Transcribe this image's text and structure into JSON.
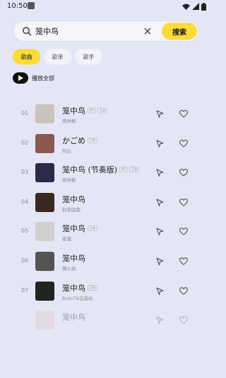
{
  "status": {
    "time": "10:50"
  },
  "search": {
    "query": "笼中鸟",
    "button_label": "搜索"
  },
  "tabs": [
    {
      "label": "歌曲",
      "active": true
    },
    {
      "label": "歌单",
      "active": false
    },
    {
      "label": "歌手",
      "active": false
    }
  ],
  "play_all": {
    "label": "播放全部"
  },
  "songs": [
    {
      "index": "01",
      "title": "笼中鸟",
      "tags": [
        "HF",
        "王者"
      ],
      "artist": "周林枫",
      "cover_color": "#c9c3bd"
    },
    {
      "index": "02",
      "title": "かごめ",
      "tags": [
        "王者"
      ],
      "artist": "阿云",
      "cover_color": "#8a5a4f"
    },
    {
      "index": "03",
      "title": "笼中鸟 (节奏版)",
      "tags": [
        "HF",
        "王者"
      ],
      "artist": "周林枫",
      "cover_color": "#2c2a48"
    },
    {
      "index": "04",
      "title": "笼中鸟",
      "tags": [],
      "artist": "封茗囧菌",
      "cover_color": "#3a2822"
    },
    {
      "index": "05",
      "title": "笼中鸟",
      "tags": [
        "王者"
      ],
      "artist": "崔健",
      "cover_color": "#d0d0d0"
    },
    {
      "index": "06",
      "title": "笼中鸟",
      "tags": [],
      "artist": "黄小琥",
      "cover_color": "#545454"
    },
    {
      "index": "07",
      "title": "笼中鸟",
      "tags": [
        "王者"
      ],
      "artist": "BrAnTB白景屹",
      "cover_color": "#1f2620"
    },
    {
      "index": "",
      "title": "笼中鸟",
      "tags": [],
      "artist": "",
      "cover_color": "#e0c9c0"
    }
  ],
  "colors": {
    "accent": "#fadb37",
    "background": "#e5e6f5"
  }
}
